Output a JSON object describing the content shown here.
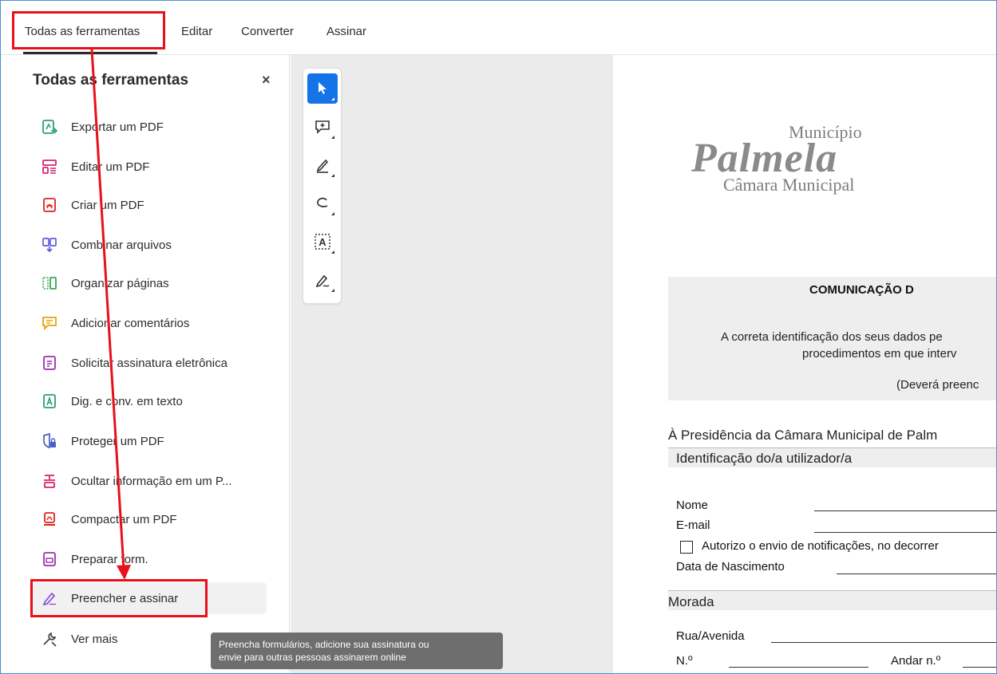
{
  "menu": {
    "tabs": [
      {
        "label": "Todas as ferramentas"
      },
      {
        "label": "Editar"
      },
      {
        "label": "Converter"
      },
      {
        "label": "Assinar"
      }
    ]
  },
  "panel": {
    "title": "Todas as ferramentas",
    "close": "×",
    "items": [
      {
        "label": "Exportar um PDF",
        "icon": "export-pdf-icon"
      },
      {
        "label": "Editar um PDF",
        "icon": "edit-pdf-icon"
      },
      {
        "label": "Criar um PDF",
        "icon": "create-pdf-icon"
      },
      {
        "label": "Combinar arquivos",
        "icon": "combine-files-icon"
      },
      {
        "label": "Organizar páginas",
        "icon": "organize-pages-icon"
      },
      {
        "label": "Adicionar comentários",
        "icon": "add-comment-icon"
      },
      {
        "label": "Solicitar assinatura eletrônica",
        "icon": "request-esign-icon"
      },
      {
        "label": "Dig. e conv. em texto",
        "icon": "scan-ocr-icon"
      },
      {
        "label": "Proteger um PDF",
        "icon": "protect-pdf-icon"
      },
      {
        "label": "Ocultar informação em um P...",
        "icon": "redact-icon"
      },
      {
        "label": "Compactar um PDF",
        "icon": "compress-pdf-icon"
      },
      {
        "label": "Preparar form.",
        "icon": "prepare-form-icon"
      },
      {
        "label": "Preencher e assinar",
        "icon": "fill-sign-icon"
      },
      {
        "label": "Ver mais",
        "icon": "tools-more-icon"
      }
    ]
  },
  "toolbar": {
    "tools": [
      "select-cursor-icon",
      "add-comment-icon",
      "highlight-pen-icon",
      "draw-freeform-icon",
      "text-recognition-icon",
      "fill-sign-pen-icon"
    ],
    "text_tool_label": "A"
  },
  "tooltip": {
    "line1": "Preencha formulários, adicione sua assinatura ou",
    "line2": "envie para outras pessoas assinarem online"
  },
  "document": {
    "logo_top": "Município",
    "logo_main": "Palmela",
    "logo_bottom": "Câmara Municipal",
    "heading": "COMUNICAÇÃO D",
    "intro_line1": "A correta identificação dos seus dados pe",
    "intro_line2": "procedimentos em que interv",
    "intro_line3": "(Deverá preenc",
    "addressee": "À Presidência da Câmara Municipal de Palm",
    "section_id": "Identificação do/a utilizador/a",
    "field_nome": "Nome",
    "field_email": "E-mail",
    "consent": "Autorizo o envio de notificações, no decorrer",
    "field_birth": "Data de Nascimento",
    "section_address": "Morada",
    "field_street": "Rua/Avenida",
    "field_number": "N.º",
    "field_floor": "Andar n.º"
  },
  "colors": {
    "accent": "#1473e6",
    "annotation": "#e8101a"
  }
}
